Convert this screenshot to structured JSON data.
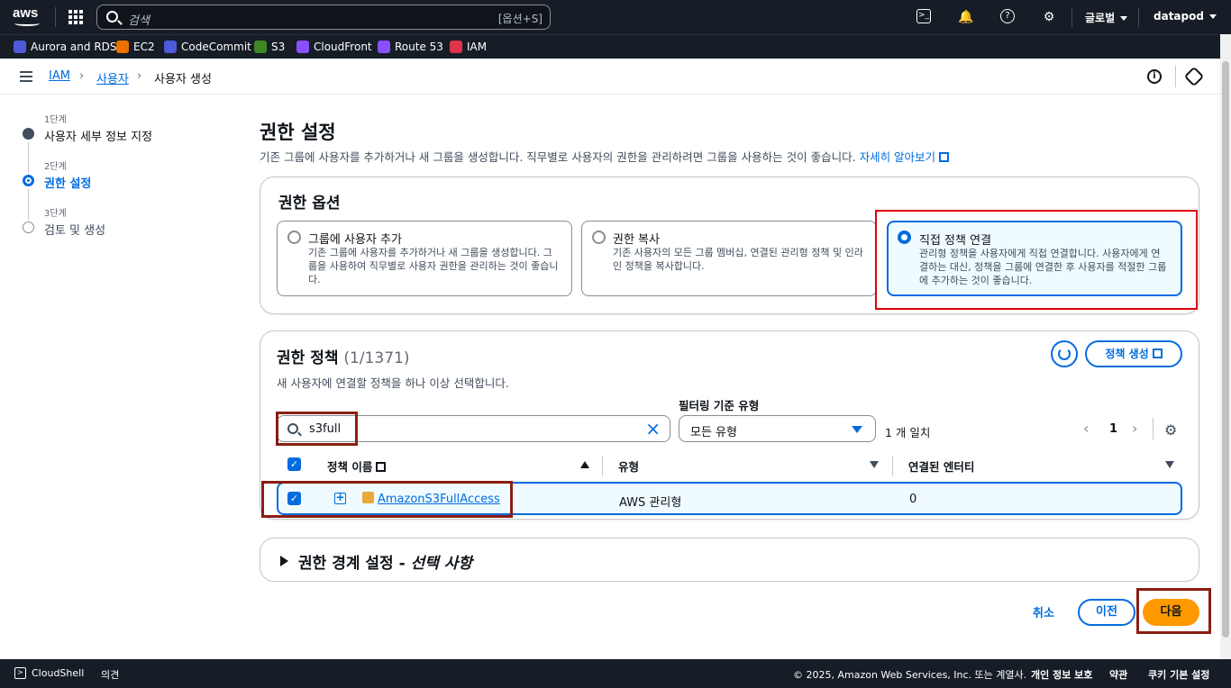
{
  "topnav": {
    "logo": "aws",
    "search_placeholder": "검색",
    "search_shortcut": "[옵션+S]",
    "region": "글로벌",
    "account": "datapod"
  },
  "favorites": [
    {
      "label": "Aurora and RDS",
      "color": "#4d5bd9"
    },
    {
      "label": "EC2",
      "color": "#ed7100"
    },
    {
      "label": "CodeCommit",
      "color": "#4d5bd9"
    },
    {
      "label": "S3",
      "color": "#3f8624"
    },
    {
      "label": "CloudFront",
      "color": "#8c4fff"
    },
    {
      "label": "Route 53",
      "color": "#8c4fff"
    },
    {
      "label": "IAM",
      "color": "#dd344c"
    }
  ],
  "breadcrumb": {
    "root": "IAM",
    "parent": "사용자",
    "current": "사용자 생성"
  },
  "steps": [
    {
      "num": "1단계",
      "name": "사용자 세부 정보 지정"
    },
    {
      "num": "2단계",
      "name": "권한 설정"
    },
    {
      "num": "3단계",
      "name": "검토 및 생성"
    }
  ],
  "main": {
    "title": "권한 설정",
    "desc": "기존 그룹에 사용자를 추가하거나 새 그룹을 생성합니다. 직무별로 사용자의 권한을 관리하려면 그룹을 사용하는 것이 좋습니다.",
    "learn_more": "자세히 알아보기"
  },
  "options": {
    "title": "권한 옵션",
    "items": [
      {
        "title": "그룹에 사용자 추가",
        "desc": "기존 그룹에 사용자를 추가하거나 새 그룹을 생성합니다. 그룹을 사용하여 직무별로 사용자 권한을 관리하는 것이 좋습니다."
      },
      {
        "title": "권한 복사",
        "desc": "기존 사용자의 모든 그룹 멤버십, 연결된 관리형 정책 및 인라인 정책을 복사합니다."
      },
      {
        "title": "직접 정책 연결",
        "desc": "관리형 정책을 사용자에게 직접 연결합니다. 사용자에게 연결하는 대신, 정책을 그룹에 연결한 후 사용자를 적절한 그룹에 추가하는 것이 좋습니다."
      }
    ]
  },
  "policies": {
    "title": "권한 정책",
    "count": "(1/1371)",
    "desc": "새 사용자에 연결할 정책을 하나 이상 선택합니다.",
    "create_label": "정책 생성",
    "filter_label": "필터링 기준 유형",
    "search_value": "s3full",
    "type_value": "모든 유형",
    "match": "1 개 일치",
    "page": "1",
    "columns": [
      "정책 이름",
      "유형",
      "연결된 엔터티"
    ],
    "rows": [
      {
        "name": "AmazonS3FullAccess",
        "type": "AWS 관리형",
        "entities": "0"
      }
    ]
  },
  "boundary": {
    "title": "권한 경계 설정 - ",
    "optional": "선택 사항"
  },
  "actions": {
    "cancel": "취소",
    "prev": "이전",
    "next": "다음"
  },
  "footer": {
    "cloudshell": "CloudShell",
    "feedback": "의견",
    "copyright": "© 2025, Amazon Web Services, Inc. 또는 계열사.",
    "privacy": "개인 정보 보호",
    "terms": "약관",
    "cookies": "쿠키 기본 설정"
  }
}
